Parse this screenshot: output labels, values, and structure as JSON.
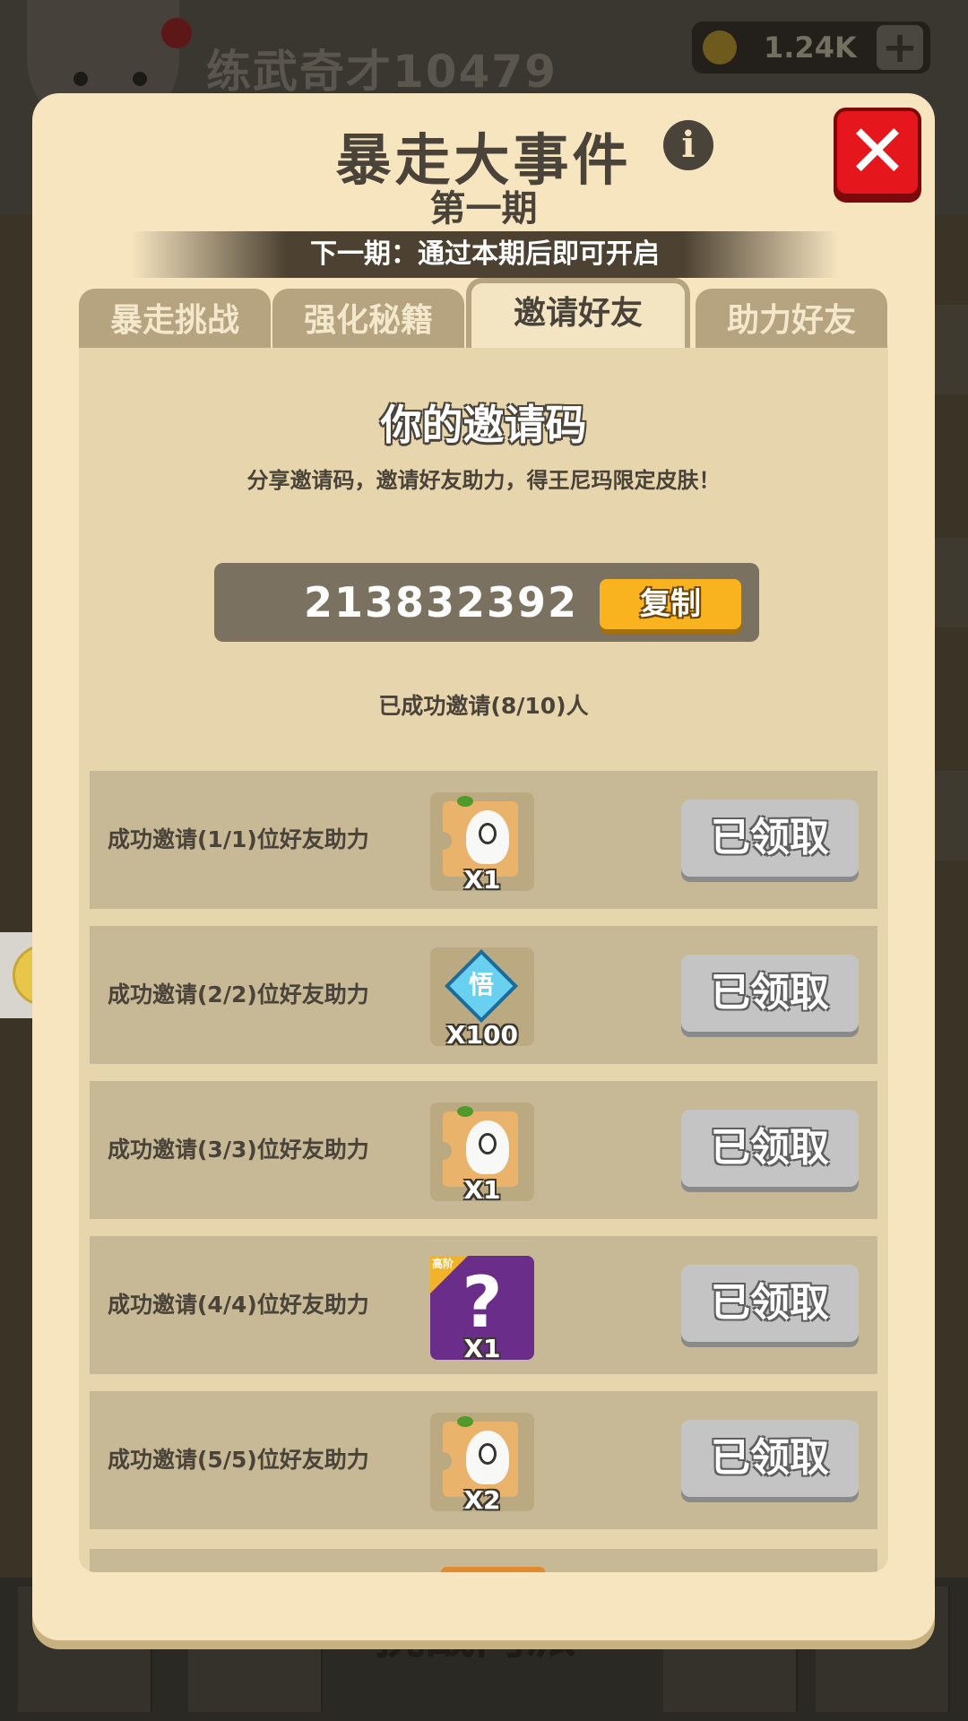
{
  "background": {
    "player_name": "练武奇才10479",
    "coins": "1.24K",
    "bottom_title": "挑战门派"
  },
  "modal": {
    "title": "暴走大事件",
    "subtitle": "第一期",
    "banner": "下一期：通过本期后即可开启",
    "tabs": [
      {
        "label": "暴走挑战",
        "active": false
      },
      {
        "label": "强化秘籍",
        "active": false
      },
      {
        "label": "邀请好友",
        "active": true
      },
      {
        "label": "助力好友",
        "active": false
      }
    ]
  },
  "invite": {
    "heading": "你的邀请码",
    "description": "分享邀请码，邀请好友助力，得王尼玛限定皮肤！",
    "code": "213832392",
    "copy_label": "复制",
    "progress_text": "已成功邀请(8/10)人",
    "rows": [
      {
        "label": "成功邀请(1/1)位好友助力",
        "reward_icon": "ghost-card-icon",
        "qty": "X1",
        "button": "已领取"
      },
      {
        "label": "成功邀请(2/2)位好友助力",
        "reward_icon": "insight-gem-icon",
        "gem_char": "悟",
        "qty": "X100",
        "button": "已领取"
      },
      {
        "label": "成功邀请(3/3)位好友助力",
        "reward_icon": "ghost-card-icon",
        "qty": "X1",
        "button": "已领取"
      },
      {
        "label": "成功邀请(4/4)位好友助力",
        "reward_icon": "mystery-box-icon",
        "corner": "高阶",
        "qty": "X1",
        "button": "已领取"
      },
      {
        "label": "成功邀请(5/5)位好友助力",
        "reward_icon": "ghost-card-icon",
        "qty": "X2",
        "button": "已领取"
      }
    ]
  },
  "colors": {
    "modal_bg": "#f7e5c0",
    "panel_bg": "#e7d6ad",
    "row_bg": "#c8b996",
    "close_red": "#e5161c",
    "copy_orange": "#f8b31e",
    "claimed_gray": "#c4c4c4"
  }
}
